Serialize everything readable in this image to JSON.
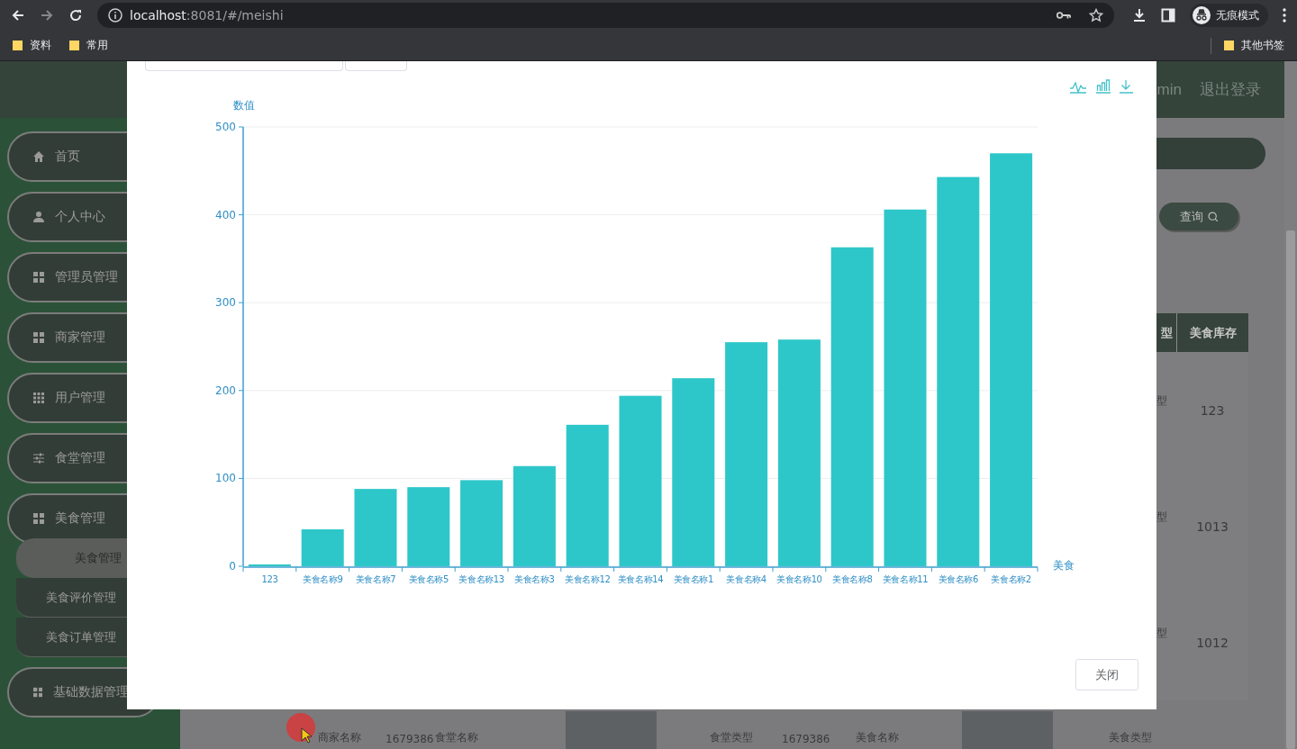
{
  "browser": {
    "url_host": "localhost",
    "url_rest": ":8081/#/meishi",
    "profile": "无痕模式",
    "bookmarks": [
      {
        "label": "资料"
      },
      {
        "label": "常用"
      }
    ],
    "other_bookmarks": "其他书签"
  },
  "header": {
    "user": "min",
    "logout": "退出登录"
  },
  "sidebar": {
    "items": [
      {
        "label": "首页",
        "kind": "home"
      },
      {
        "label": "个人中心",
        "kind": "user"
      },
      {
        "label": "管理员管理",
        "kind": "grid4"
      },
      {
        "label": "商家管理",
        "kind": "grid4"
      },
      {
        "label": "用户管理",
        "kind": "grid9"
      },
      {
        "label": "食堂管理",
        "kind": "sliders"
      },
      {
        "label": "美食管理",
        "kind": "grid4",
        "expanded": true,
        "children": [
          {
            "label": "美食管理",
            "selected": true
          },
          {
            "label": "美食评价管理",
            "selected": false
          },
          {
            "label": "美食订单管理",
            "selected": false
          }
        ]
      },
      {
        "label": "基础数据管理",
        "kind": "grid4",
        "expanded": false
      }
    ]
  },
  "main": {
    "search_button": "查询",
    "table": {
      "columns": [
        "型",
        "美食库存"
      ],
      "rows": [
        {
          "column_1": "型",
          "stock": "123"
        },
        {
          "column_1": "型",
          "stock": "1013"
        },
        {
          "column_1": "型",
          "stock": "1012"
        }
      ]
    },
    "bottom_row": [
      {
        "kind": "text",
        "text": "商家名称"
      },
      {
        "kind": "text",
        "text": "1679386"
      },
      {
        "kind": "text",
        "text": "食堂名称"
      },
      {
        "kind": "photo"
      },
      {
        "kind": "text",
        "text": "食堂类型"
      },
      {
        "kind": "text",
        "text": "1679386"
      },
      {
        "kind": "text",
        "text": "美食名称"
      },
      {
        "kind": "photo"
      },
      {
        "kind": "text",
        "text": "美食类型"
      }
    ]
  },
  "dialog": {
    "close_button": "关闭",
    "chart_data": {
      "type": "bar",
      "xlabel": "美食",
      "ylabel": "数值",
      "categories": [
        "123",
        "美食名称9",
        "美食名称7",
        "美食名称5",
        "美食名称13",
        "美食名称3",
        "美食名称12",
        "美食名称14",
        "美食名称1",
        "美食名称4",
        "美食名称10",
        "美食名称8",
        "美食名称11",
        "美食名称6",
        "美食名称2"
      ],
      "values": [
        1,
        42,
        88,
        90,
        98,
        114,
        161,
        194,
        214,
        255,
        258,
        363,
        406,
        443,
        470
      ],
      "grid": true,
      "ylim": [
        0,
        500
      ],
      "yticks": [
        0,
        100,
        200,
        300,
        400,
        500
      ]
    }
  }
}
